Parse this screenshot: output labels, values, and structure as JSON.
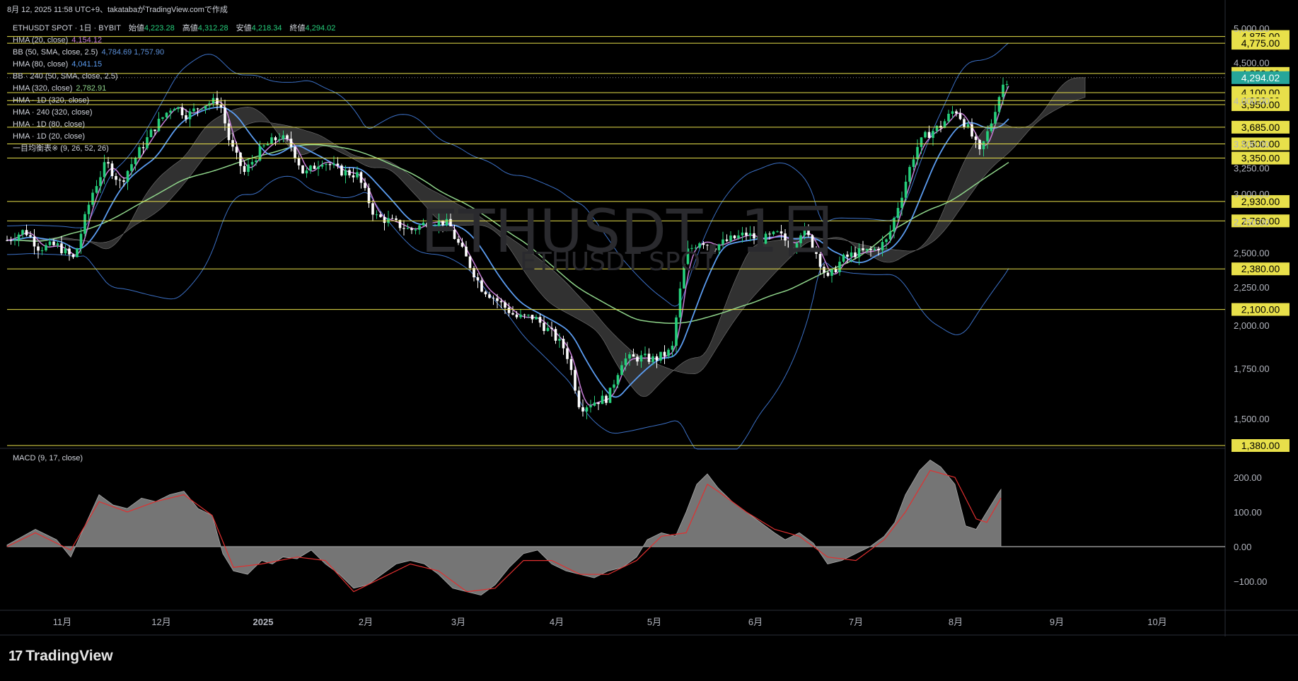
{
  "header": {
    "text": "8月 12, 2025 11:58 UTC+9、takatabaがTradingView.comで作成"
  },
  "symbol": {
    "title": "ETHUSDT SPOT · 1日 · BYBIT",
    "open_label": "始値",
    "open": "4,223.28",
    "high_label": "高値",
    "high": "4,312.28",
    "low_label": "安値",
    "low": "4,218.34",
    "close_label": "終値",
    "close": "4,294.02"
  },
  "watermark": {
    "main": "ETHUSDT, 1日",
    "sub": "ETHUSDT SPOT"
  },
  "indicators": [
    {
      "label": "HMA (20, close)",
      "value": "4,154.12",
      "color": "#c77dd7"
    },
    {
      "label": "BB (50, SMA, close, 2.5)",
      "value": "4,784.69  1,757.90",
      "color": "#5b8fd8"
    },
    {
      "label": "HMA (80, close)",
      "value": "4,041.15",
      "color": "#5b9cf0"
    },
    {
      "label": "BB · 240 (50, SMA, close, 2.5)",
      "value": "",
      "color": "#d1d4dc"
    },
    {
      "label": "HMA (320, close)",
      "value": "2,782.91",
      "color": "#8fd48a"
    },
    {
      "label": "HMA · 1D (320, close)",
      "value": "",
      "color": "#d1d4dc"
    },
    {
      "label": "HMA · 240 (320, close)",
      "value": "",
      "color": "#d1d4dc"
    },
    {
      "label": "HMA · 1D (80, close)",
      "value": "",
      "color": "#d1d4dc"
    },
    {
      "label": "HMA · 1D (20, close)",
      "value": "",
      "color": "#d1d4dc"
    },
    {
      "label": "一目均衡表※ (9, 26, 52, 26)",
      "value": "",
      "color": "#d1d4dc"
    }
  ],
  "macd": {
    "label": "MACD (9, 17, close)"
  },
  "brand": {
    "logo": "17",
    "name": "TradingView"
  },
  "chart_data": [
    {
      "type": "candlestick",
      "title": "ETHUSDT SPOT · 1日 · BYBIT",
      "x_labels": [
        "11月",
        "12月",
        "2025",
        "2月",
        "3月",
        "4月",
        "5月",
        "6月",
        "7月",
        "8月",
        "9月",
        "10月"
      ],
      "y_ticks": [
        5000,
        4500,
        4000,
        3500,
        3250,
        3000,
        2750,
        2500,
        2250,
        2000,
        1750,
        1500
      ],
      "y_tick_labels": [
        "5,000.00",
        "4,500.00",
        "4,000.00",
        "3,500.00",
        "3,250.00",
        "3,000.00",
        "2,750.00",
        "2,500.00",
        "2,250.00",
        "2,000.00",
        "1,750.00",
        "1,500.00"
      ],
      "horizontal_levels": [
        4875,
        4775,
        4350,
        4100,
        4000,
        3950,
        3685,
        3500,
        3350,
        2930,
        2760,
        2380,
        2100,
        1380
      ],
      "horizontal_level_labels": [
        "4,875.00",
        "4,775.00",
        "4,350.00",
        "4,100.00",
        "4,000.00",
        "3,950.00",
        "3,685.00",
        "3,500.00",
        "3,350.00",
        "2,930.00",
        "2,760.00",
        "2,380.00",
        "2,100.00",
        "1,380.00"
      ],
      "level_color": "#e8e04a",
      "last_price": 4294.02,
      "last_price_label": "4,294.02",
      "last_price_color": "#26a69a",
      "up_color": "#26d07c",
      "down_color": "#ffffff",
      "close_path": [
        [
          0,
          2600
        ],
        [
          25,
          2680
        ],
        [
          45,
          2540
        ],
        [
          70,
          2560
        ],
        [
          95,
          2450
        ],
        [
          120,
          3000
        ],
        [
          140,
          3300
        ],
        [
          160,
          3100
        ],
        [
          185,
          3400
        ],
        [
          210,
          3700
        ],
        [
          235,
          3950
        ],
        [
          255,
          3820
        ],
        [
          275,
          3950
        ],
        [
          300,
          4000
        ],
        [
          315,
          3500
        ],
        [
          335,
          3200
        ],
        [
          360,
          3450
        ],
        [
          385,
          3580
        ],
        [
          400,
          3500
        ],
        [
          420,
          3180
        ],
        [
          445,
          3330
        ],
        [
          470,
          3220
        ],
        [
          495,
          3180
        ],
        [
          520,
          2800
        ],
        [
          545,
          2750
        ],
        [
          570,
          2680
        ],
        [
          595,
          2750
        ],
        [
          620,
          2750
        ],
        [
          645,
          2500
        ],
        [
          670,
          2250
        ],
        [
          695,
          2150
        ],
        [
          720,
          2050
        ],
        [
          745,
          2050
        ],
        [
          770,
          1950
        ],
        [
          790,
          1850
        ],
        [
          810,
          1550
        ],
        [
          830,
          1580
        ],
        [
          850,
          1600
        ],
        [
          870,
          1800
        ],
        [
          895,
          1810
        ],
        [
          915,
          1800
        ],
        [
          940,
          1850
        ],
        [
          960,
          2500
        ],
        [
          980,
          2600
        ],
        [
          1000,
          2550
        ],
        [
          1020,
          2600
        ],
        [
          1045,
          2650
        ],
        [
          1065,
          2600
        ],
        [
          1090,
          2650
        ],
        [
          1110,
          2550
        ],
        [
          1125,
          2700
        ],
        [
          1140,
          2550
        ],
        [
          1160,
          2300
        ],
        [
          1180,
          2450
        ],
        [
          1200,
          2500
        ],
        [
          1225,
          2520
        ],
        [
          1245,
          2600
        ],
        [
          1265,
          3000
        ],
        [
          1285,
          3450
        ],
        [
          1300,
          3600
        ],
        [
          1320,
          3700
        ],
        [
          1340,
          3900
        ],
        [
          1360,
          3650
        ],
        [
          1375,
          3400
        ],
        [
          1390,
          3700
        ],
        [
          1400,
          4000
        ],
        [
          1410,
          4250
        ],
        [
          1417,
          4294
        ]
      ],
      "hma20_color": "#c77dd7",
      "hma80_color": "#5b9cf0",
      "hma320_color": "#8fd48a",
      "bb_color": "#3b6fc4",
      "cloud_color": "#3a3a3a"
    },
    {
      "type": "area",
      "title": "MACD (9, 17, close)",
      "y_ticks": [
        200,
        100,
        0,
        -100
      ],
      "y_tick_labels": [
        "200.00",
        "100.00",
        "0.00",
        "−100.00"
      ],
      "macd_path": [
        [
          0,
          5
        ],
        [
          40,
          50
        ],
        [
          70,
          20
        ],
        [
          90,
          -30
        ],
        [
          110,
          60
        ],
        [
          130,
          150
        ],
        [
          150,
          120
        ],
        [
          170,
          110
        ],
        [
          190,
          140
        ],
        [
          210,
          130
        ],
        [
          230,
          150
        ],
        [
          250,
          160
        ],
        [
          270,
          110
        ],
        [
          290,
          90
        ],
        [
          305,
          -20
        ],
        [
          320,
          -70
        ],
        [
          340,
          -80
        ],
        [
          360,
          -40
        ],
        [
          375,
          -50
        ],
        [
          390,
          -30
        ],
        [
          410,
          -35
        ],
        [
          430,
          -10
        ],
        [
          450,
          -50
        ],
        [
          470,
          -80
        ],
        [
          490,
          -120
        ],
        [
          510,
          -110
        ],
        [
          530,
          -80
        ],
        [
          550,
          -50
        ],
        [
          570,
          -40
        ],
        [
          590,
          -50
        ],
        [
          610,
          -80
        ],
        [
          630,
          -120
        ],
        [
          650,
          -130
        ],
        [
          670,
          -140
        ],
        [
          690,
          -110
        ],
        [
          710,
          -60
        ],
        [
          730,
          -20
        ],
        [
          750,
          -10
        ],
        [
          770,
          -50
        ],
        [
          790,
          -70
        ],
        [
          810,
          -80
        ],
        [
          830,
          -90
        ],
        [
          850,
          -70
        ],
        [
          870,
          -60
        ],
        [
          890,
          -30
        ],
        [
          905,
          20
        ],
        [
          925,
          40
        ],
        [
          945,
          30
        ],
        [
          960,
          100
        ],
        [
          975,
          180
        ],
        [
          990,
          210
        ],
        [
          1005,
          170
        ],
        [
          1025,
          130
        ],
        [
          1045,
          100
        ],
        [
          1065,
          70
        ],
        [
          1085,
          40
        ],
        [
          1100,
          20
        ],
        [
          1120,
          40
        ],
        [
          1140,
          10
        ],
        [
          1160,
          -50
        ],
        [
          1180,
          -40
        ],
        [
          1200,
          -20
        ],
        [
          1220,
          0
        ],
        [
          1240,
          30
        ],
        [
          1255,
          70
        ],
        [
          1270,
          150
        ],
        [
          1290,
          220
        ],
        [
          1305,
          250
        ],
        [
          1320,
          230
        ],
        [
          1340,
          180
        ],
        [
          1355,
          60
        ],
        [
          1370,
          50
        ],
        [
          1385,
          100
        ],
        [
          1400,
          150
        ],
        [
          1405,
          165
        ]
      ],
      "signal_path": [
        [
          0,
          0
        ],
        [
          40,
          40
        ],
        [
          90,
          -10
        ],
        [
          130,
          130
        ],
        [
          170,
          100
        ],
        [
          210,
          130
        ],
        [
          250,
          150
        ],
        [
          290,
          90
        ],
        [
          320,
          -60
        ],
        [
          360,
          -50
        ],
        [
          410,
          -30
        ],
        [
          450,
          -40
        ],
        [
          490,
          -130
        ],
        [
          530,
          -90
        ],
        [
          570,
          -50
        ],
        [
          610,
          -70
        ],
        [
          650,
          -130
        ],
        [
          690,
          -120
        ],
        [
          730,
          -40
        ],
        [
          770,
          -40
        ],
        [
          810,
          -80
        ],
        [
          850,
          -80
        ],
        [
          890,
          -40
        ],
        [
          925,
          30
        ],
        [
          960,
          40
        ],
        [
          990,
          180
        ],
        [
          1005,
          160
        ],
        [
          1045,
          100
        ],
        [
          1085,
          50
        ],
        [
          1120,
          30
        ],
        [
          1160,
          -30
        ],
        [
          1200,
          -40
        ],
        [
          1240,
          20
        ],
        [
          1270,
          100
        ],
        [
          1305,
          220
        ],
        [
          1340,
          200
        ],
        [
          1370,
          80
        ],
        [
          1385,
          70
        ],
        [
          1405,
          140
        ]
      ],
      "area_color": "#8a8a8a",
      "signal_color": "#e03030"
    }
  ]
}
